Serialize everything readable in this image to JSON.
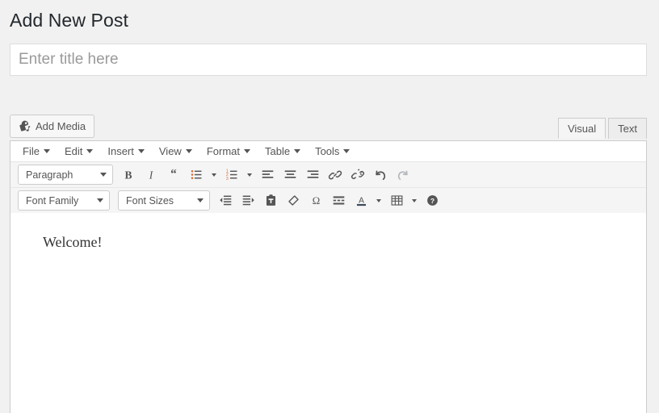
{
  "page": {
    "title": "Add New Post"
  },
  "title_field": {
    "value": "",
    "placeholder": "Enter title here"
  },
  "toolbar": {
    "add_media_label": "Add Media",
    "add_media_icon": "media-icon"
  },
  "editor_tabs": [
    {
      "label": "Visual",
      "active": true
    },
    {
      "label": "Text",
      "active": false
    }
  ],
  "menubar": [
    {
      "label": "File"
    },
    {
      "label": "Edit"
    },
    {
      "label": "Insert"
    },
    {
      "label": "View"
    },
    {
      "label": "Format"
    },
    {
      "label": "Table"
    },
    {
      "label": "Tools"
    }
  ],
  "format_select": {
    "value": "Paragraph"
  },
  "font_family_select": {
    "value": "Font Family"
  },
  "font_sizes_select": {
    "value": "Font Sizes"
  },
  "toolbar_row1": [
    {
      "name": "bold-icon",
      "title": "Bold"
    },
    {
      "name": "italic-icon",
      "title": "Italic"
    },
    {
      "name": "blockquote-icon",
      "title": "Blockquote"
    },
    {
      "name": "bullet-list-icon",
      "title": "Bulleted list"
    },
    {
      "name": "numbered-list-icon",
      "title": "Numbered list"
    },
    {
      "name": "align-left-icon",
      "title": "Align left"
    },
    {
      "name": "align-center-icon",
      "title": "Align center"
    },
    {
      "name": "align-right-icon",
      "title": "Align right"
    },
    {
      "name": "link-icon",
      "title": "Insert/edit link"
    },
    {
      "name": "unlink-icon",
      "title": "Remove link"
    },
    {
      "name": "undo-icon",
      "title": "Undo"
    },
    {
      "name": "redo-icon",
      "title": "Redo"
    }
  ],
  "toolbar_row2": [
    {
      "name": "decrease-indent-icon",
      "title": "Decrease indent"
    },
    {
      "name": "increase-indent-icon",
      "title": "Increase indent"
    },
    {
      "name": "paste-as-text-icon",
      "title": "Paste as text"
    },
    {
      "name": "clear-formatting-icon",
      "title": "Clear formatting"
    },
    {
      "name": "special-character-icon",
      "title": "Special character"
    },
    {
      "name": "horizontal-line-icon",
      "title": "Horizontal line"
    },
    {
      "name": "text-color-icon",
      "title": "Text color"
    },
    {
      "name": "table-icon",
      "title": "Table"
    },
    {
      "name": "help-icon",
      "title": "Keyboard shortcuts"
    }
  ],
  "content": {
    "paragraph": "Welcome!"
  },
  "colors": {
    "page_background": "#f1f1f1",
    "panel_background": "#ffffff",
    "toolbar_background": "#f5f5f5",
    "border": "#cccccc",
    "text": "#555555",
    "heading": "#23282d",
    "icon_accent": "#d96a35",
    "disabled": "#b4b9be"
  }
}
